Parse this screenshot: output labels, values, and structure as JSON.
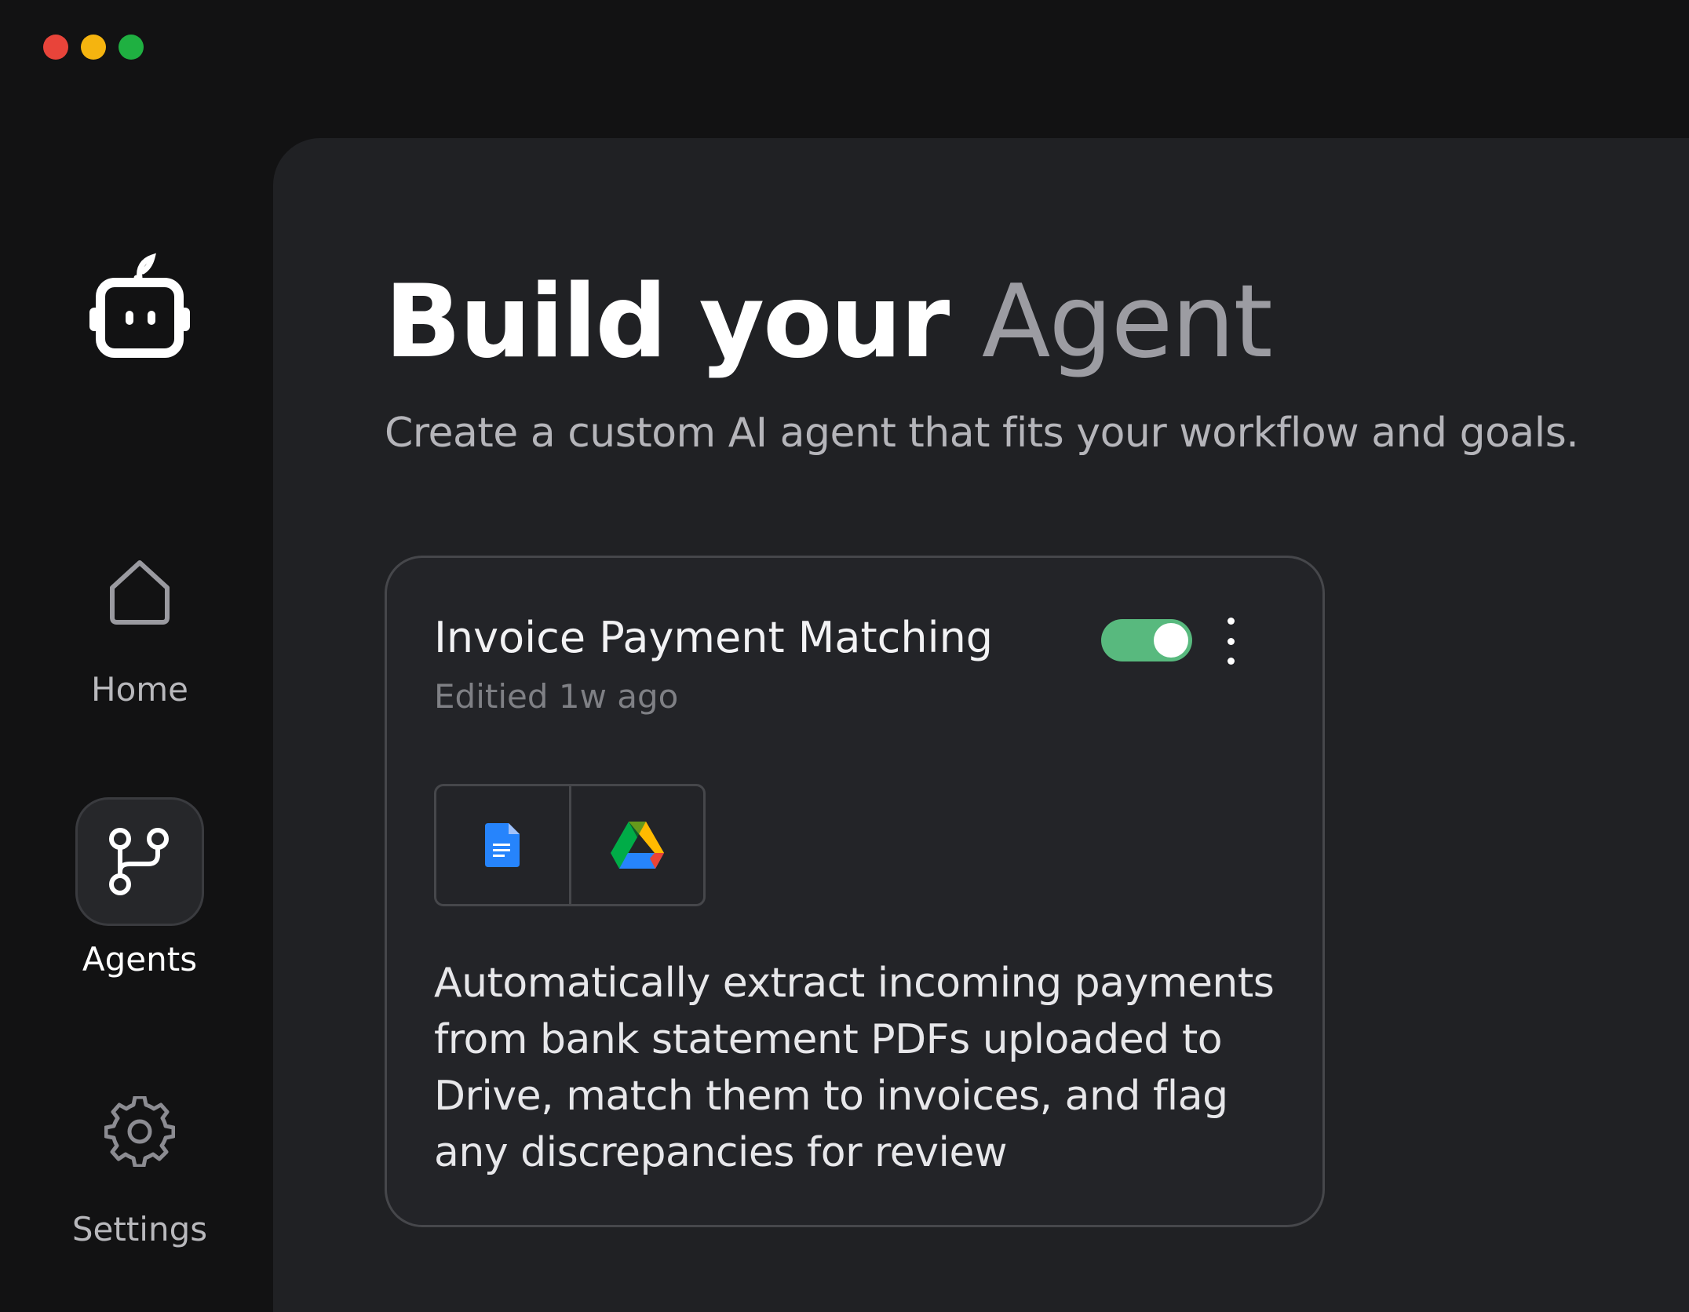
{
  "window": {
    "controls": [
      "close",
      "minimize",
      "maximize"
    ],
    "colors": {
      "close": "#e8443a",
      "minimize": "#f5b40f",
      "maximize": "#1fb041"
    }
  },
  "sidebar": {
    "logo_icon": "robot-icon",
    "items": [
      {
        "label": "Home",
        "icon": "home-icon",
        "active": false
      },
      {
        "label": "Agents",
        "icon": "git-branch-icon",
        "active": true
      },
      {
        "label": "Settings",
        "icon": "gear-icon",
        "active": false
      }
    ]
  },
  "main": {
    "title_primary": "Build your",
    "title_accent": "Agent",
    "subtitle": "Create a custom AI agent that fits your workflow and goals."
  },
  "card": {
    "title": "Invoice Payment Matching",
    "meta": "Editied 1w ago",
    "enabled": true,
    "toggle_color": "#58b97e",
    "integrations": [
      {
        "name": "google-docs-icon",
        "color": "#2684fc"
      },
      {
        "name": "google-drive-icon"
      }
    ],
    "description": "Automatically extract incoming payments from bank statement PDFs uploaded to Drive, match them to invoices, and flag any discrepancies for review"
  }
}
